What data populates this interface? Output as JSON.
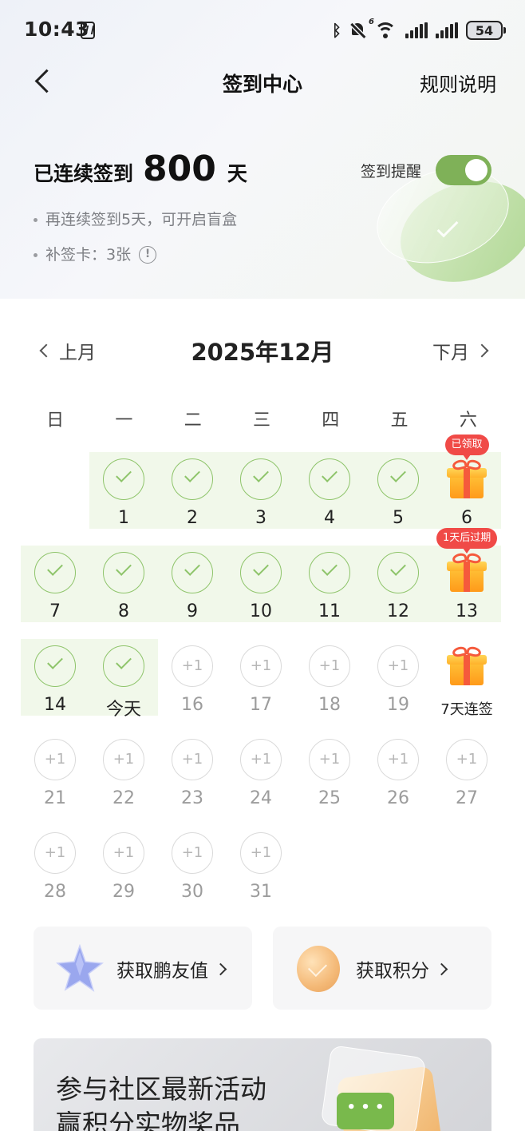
{
  "status_bar": {
    "time": "10:43",
    "battery": "54"
  },
  "nav": {
    "title": "签到中心",
    "rules": "规则说明"
  },
  "header": {
    "streak_prefix": "已连续签到",
    "streak_days": "800",
    "streak_suffix": "天",
    "reminder_label": "签到提醒",
    "reminder_on": true,
    "tip_blindbox": "再连续签到5天，可开启盲盒",
    "tip_makeup": "补签卡：3张"
  },
  "calendar": {
    "prev": "上月",
    "month": "2025年12月",
    "next": "下月",
    "weekdays": [
      "日",
      "一",
      "二",
      "三",
      "四",
      "五",
      "六"
    ],
    "plus_label": "+1",
    "days": [
      {
        "day": "1",
        "state": "done"
      },
      {
        "day": "2",
        "state": "done"
      },
      {
        "day": "3",
        "state": "done"
      },
      {
        "day": "4",
        "state": "done"
      },
      {
        "day": "5",
        "state": "done"
      },
      {
        "day": "6",
        "state": "gift",
        "tag": "已领取"
      },
      {
        "day": "7",
        "state": "done"
      },
      {
        "day": "8",
        "state": "done"
      },
      {
        "day": "9",
        "state": "done"
      },
      {
        "day": "10",
        "state": "done"
      },
      {
        "day": "11",
        "state": "done"
      },
      {
        "day": "12",
        "state": "done"
      },
      {
        "day": "13",
        "state": "gift",
        "tag": "1天后过期"
      },
      {
        "day": "14",
        "state": "done"
      },
      {
        "day": "今天",
        "state": "done"
      },
      {
        "day": "16",
        "state": "future"
      },
      {
        "day": "17",
        "state": "future"
      },
      {
        "day": "18",
        "state": "future"
      },
      {
        "day": "19",
        "state": "future"
      },
      {
        "day": "7天连签",
        "state": "gift"
      },
      {
        "day": "21",
        "state": "future"
      },
      {
        "day": "22",
        "state": "future"
      },
      {
        "day": "23",
        "state": "future"
      },
      {
        "day": "24",
        "state": "future"
      },
      {
        "day": "25",
        "state": "future"
      },
      {
        "day": "26",
        "state": "future"
      },
      {
        "day": "27",
        "state": "future"
      },
      {
        "day": "28",
        "state": "future"
      },
      {
        "day": "29",
        "state": "future"
      },
      {
        "day": "30",
        "state": "future"
      },
      {
        "day": "31",
        "state": "future"
      }
    ]
  },
  "cards": {
    "friend_value": "获取鹏友值",
    "points": "获取积分"
  },
  "banner": {
    "line1": "参与社区最新活动",
    "line2": "赢积分实物奖品"
  },
  "colors": {
    "accent_green": "#8ec46a",
    "toggle_green": "#7fb158",
    "tag_red": "#f04a47"
  }
}
